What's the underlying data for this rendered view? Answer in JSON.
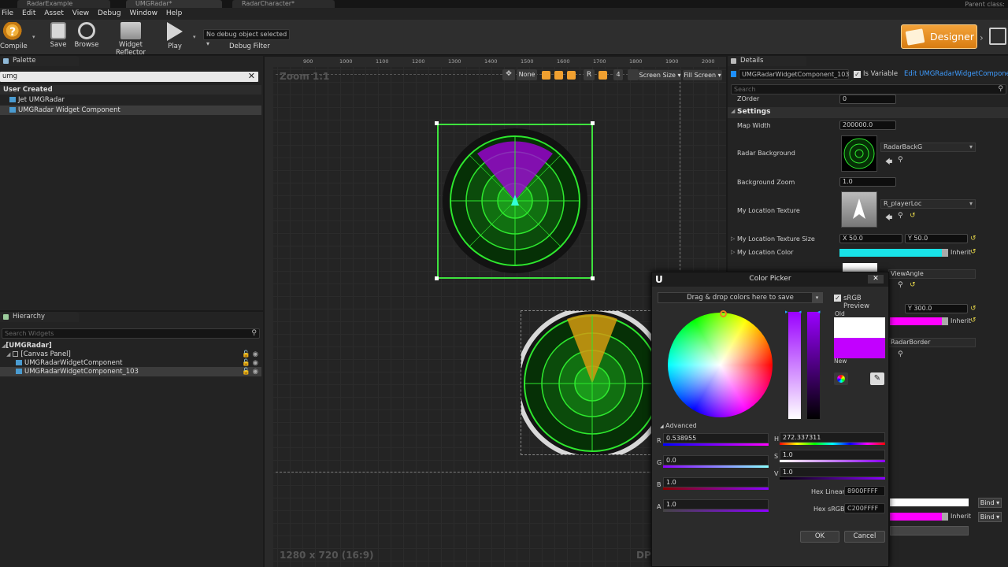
{
  "tabs": [
    "RadarExample",
    "UMGRadar*",
    "RadarCharacter*"
  ],
  "parent_class": "Parent class:",
  "menu": [
    "File",
    "Edit",
    "Asset",
    "View",
    "Debug",
    "Window",
    "Help"
  ],
  "toolbar": {
    "compile": "Compile",
    "save": "Save",
    "browse": "Browse",
    "widget_reflector": "Widget Reflector",
    "play": "Play",
    "debug_object": "No debug object selected ▾",
    "debug_filter": "Debug Filter",
    "designer": "Designer"
  },
  "palette": {
    "title": "Palette",
    "search_value": "umg",
    "category": "User Created",
    "items": [
      "Jet UMGRadar",
      "UMGRadar Widget Component"
    ]
  },
  "hierarchy": {
    "title": "Hierarchy",
    "search_placeholder": "Search Widgets",
    "items": [
      "[UMGRadar]",
      "[Canvas Panel]",
      "UMGRadarWidgetComponent",
      "UMGRadarWidgetComponent_103"
    ]
  },
  "canvas": {
    "zoom": "Zoom 1:1",
    "none_label": "None",
    "r_label": "R",
    "grid_num": "4",
    "screen_size": "Screen Size ▾",
    "fill_screen": "Fill Screen ▾",
    "resolution": "1280 x 720 (16:9)",
    "dpi": "DP",
    "ruler_ticks": [
      "900",
      "1000",
      "1100",
      "1200",
      "1300",
      "1400",
      "1500",
      "1600",
      "1700",
      "1800",
      "1900",
      "2000"
    ]
  },
  "details": {
    "title": "Details",
    "component_name": "UMGRadarWidgetComponent_103",
    "is_variable": "Is Variable",
    "edit_link": "Edit UMGRadarWidgetComponent",
    "search_placeholder": "Search",
    "zorder_label": "ZOrder",
    "zorder_value": "0",
    "settings": "Settings",
    "map_width_label": "Map Width",
    "map_width_value": "200000.0",
    "radar_background_label": "Radar Background",
    "radar_background_asset": "RadarBackG",
    "background_zoom_label": "Background Zoom",
    "background_zoom_value": "1.0",
    "my_location_texture_label": "My Location Texture",
    "my_location_texture_asset": "R_playerLoc",
    "my_location_texture_size_label": "My Location Texture Size",
    "size_x": "X  50.0",
    "size_y": "Y  50.0",
    "my_location_color_label": "My Location Color",
    "inherit": "Inherit",
    "view_angle": "ViewAngle",
    "y_300": "Y  300.0",
    "radar_border": "RadarBorder",
    "bind": "Bind ▾",
    "location_color": "#19e3e8",
    "magenta": "#ff00ff"
  },
  "color_picker": {
    "title": "Color Picker",
    "drag_drop": "Drag & drop colors here to save",
    "srgb_preview": "sRGB Preview",
    "old": "Old",
    "new": "New",
    "advanced": "Advanced",
    "r_label": "R",
    "r_value": "0.538955",
    "g_label": "G",
    "g_value": "0.0",
    "b_label": "B",
    "b_value": "1.0",
    "a_label": "A",
    "a_value": "1.0",
    "h_label": "H",
    "h_value": "272.337311",
    "s_label": "S",
    "s_value": "1.0",
    "v_label": "V",
    "v_value": "1.0",
    "hex_linear_label": "Hex Linear",
    "hex_linear_value": "8900FFFF",
    "hex_srgb_label": "Hex sRGB",
    "hex_srgb_value": "C200FFFF",
    "ok": "OK",
    "cancel": "Cancel",
    "old_color": "#ffffff",
    "new_color": "#c200ff"
  }
}
